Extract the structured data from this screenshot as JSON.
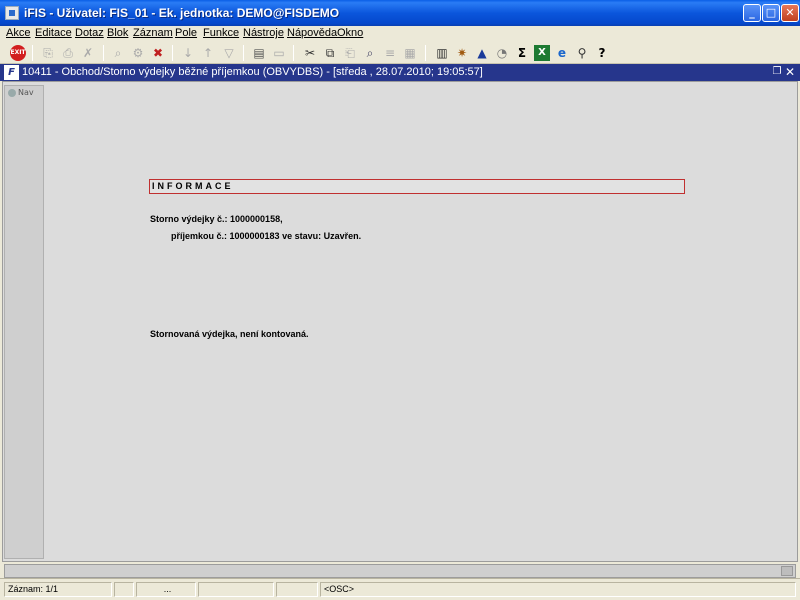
{
  "window": {
    "title": "iFIS - Uživatel: FIS_01 - Ek. jednotka: DEMO@FISDEMO"
  },
  "menu": [
    "Akce",
    "Editace",
    "Dotaz",
    "Blok",
    "Záznam",
    "Pole",
    "Funkce",
    "Nástroje",
    "Nápověda",
    "Okno"
  ],
  "toolbar": {
    "exit_label": "EXIT",
    "icons": [
      "exit-icon",
      "save-icon",
      "print-icon",
      "delete-icon",
      "query-icon",
      "execute-query-icon",
      "cancel-icon",
      "sort-asc-icon",
      "sort-desc-icon",
      "filter-icon",
      "print-preview-icon",
      "export-icon",
      "cut-icon",
      "copy-icon",
      "paste-icon",
      "find-icon",
      "list-icon",
      "grid-icon",
      "building-icon",
      "settings-icon",
      "chart-icon",
      "clock-icon",
      "sum-icon",
      "excel-icon",
      "web-icon",
      "help-search-icon",
      "help-icon"
    ]
  },
  "form": {
    "title": "10411 - Obchod/Storno výdejky běžné příjemkou (OBVYDBS) - [středa , 28.07.2010; 19:05:57]",
    "nav_label": "Nav",
    "info_header": "INFORMACE",
    "line1": "Storno výdejky č.: 1000000158,",
    "line2": "příjemkou č.: 1000000183 ve stavu: Uzavřen.",
    "line3": "Stornovaná výdejka, není kontovaná."
  },
  "status": {
    "record": "Záznam: 1/1",
    "dots": "...",
    "mode": "<OSC>"
  },
  "colors": {
    "title_bar": "#0b56dc",
    "inner_title": "#26368c",
    "info_border": "#c03030",
    "work_bg": "#dcdcdc"
  }
}
